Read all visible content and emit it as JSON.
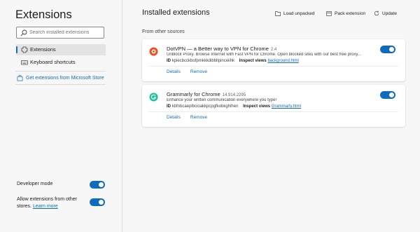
{
  "sidebar": {
    "title": "Extensions",
    "search_placeholder": "Search installed extensions",
    "items": [
      {
        "label": "Extensions",
        "icon": "gear-icon",
        "active": true
      },
      {
        "label": "Keyboard shortcuts",
        "icon": "keyboard-icon",
        "active": false
      }
    ],
    "store_link": "Get extensions from Microsoft Store",
    "developer_mode": {
      "label": "Developer mode",
      "on": true
    },
    "allow_other_stores": {
      "label": "Allow extensions from other stores.",
      "link": "Learn more",
      "on": true
    }
  },
  "main": {
    "title": "Installed extensions",
    "toolbar": {
      "load_unpacked": "Load unpacked",
      "pack_extension": "Pack extension",
      "update": "Update"
    },
    "section_label": "From other sources",
    "extensions": [
      {
        "name": "DotVPN — a Better way to VPN for Chrome",
        "version": "2.4",
        "description": "Unblock Proxy. Browse Internet with Fast VPN for Chrome. Open blocked sites with our best free proxy...",
        "id_label": "ID",
        "id": "kpiecbcckbofpmkkkdibbllpinceiihk",
        "inspect_label": "Inspect views",
        "inspect_link": "background.html",
        "details": "Details",
        "remove": "Remove",
        "enabled": true,
        "icon": "dotvpn-icon",
        "color": "#f04e23"
      },
      {
        "name": "Grammarly for Chrome",
        "version": "14.914.2295",
        "description": "Enhance your written communication everywhere you type!",
        "id_label": "ID",
        "id": "kbfnbcaeplbcioakkpcpgfkobkghlhen",
        "inspect_label": "Inspect views",
        "inspect_link": "Grammarly.html",
        "details": "Details",
        "remove": "Remove",
        "enabled": true,
        "icon": "grammarly-icon",
        "color": "#15c39a"
      }
    ]
  },
  "colors": {
    "accent": "#0f6cbd",
    "background": "#f7f7f7",
    "card": "#ffffff"
  }
}
